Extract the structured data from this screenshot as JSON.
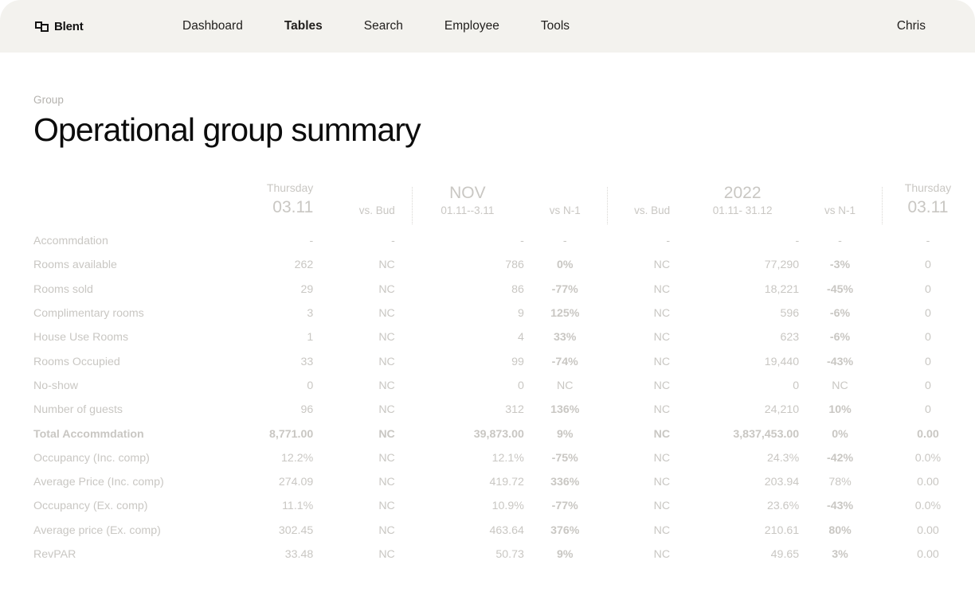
{
  "header": {
    "brand": "Blent",
    "brand_icon": "squares-logo-icon",
    "nav": [
      {
        "label": "Dashboard",
        "active": false
      },
      {
        "label": "Tables",
        "active": true
      },
      {
        "label": "Search",
        "active": false
      },
      {
        "label": "Employee",
        "active": false
      },
      {
        "label": "Tools",
        "active": false
      }
    ],
    "user": "Chris"
  },
  "page": {
    "eyebrow": "Group",
    "title": "Operational group summary"
  },
  "table": {
    "columns": [
      {
        "key": "label",
        "top": "",
        "big": "",
        "sub": ""
      },
      {
        "key": "day1",
        "top": "Thursday",
        "big": "03.11",
        "sub": ""
      },
      {
        "key": "bud1",
        "top": "",
        "big": "",
        "sub": "vs. Bud"
      },
      {
        "key": "nov",
        "top": "",
        "big": "NOV",
        "sub": "01.11--3.11"
      },
      {
        "key": "n1a",
        "top": "",
        "big": "",
        "sub": "vs N-1"
      },
      {
        "key": "bud2",
        "top": "",
        "big": "",
        "sub": "vs. Bud"
      },
      {
        "key": "year",
        "top": "",
        "big": "2022",
        "sub": "01.11- 31.12"
      },
      {
        "key": "n1b",
        "top": "",
        "big": "",
        "sub": "vs N-1"
      },
      {
        "key": "day2",
        "top": "Thursday",
        "big": "03.11",
        "sub": ""
      }
    ],
    "rows": [
      {
        "label": "Accommdation",
        "total": false,
        "cells": [
          {
            "v": "-",
            "tone": "muted"
          },
          {
            "v": "-",
            "tone": "muted"
          },
          {
            "v": "-",
            "tone": "muted"
          },
          {
            "v": "-",
            "tone": "muted"
          },
          {
            "v": "-",
            "tone": "muted"
          },
          {
            "v": "-",
            "tone": "muted"
          },
          {
            "v": "-",
            "tone": "muted"
          },
          {
            "v": "-",
            "tone": "muted"
          }
        ]
      },
      {
        "label": "Rooms available",
        "total": false,
        "cells": [
          {
            "v": "262",
            "tone": "muted"
          },
          {
            "v": "NC",
            "tone": "muted"
          },
          {
            "v": "786",
            "tone": "muted"
          },
          {
            "v": "0%",
            "tone": "pos"
          },
          {
            "v": "NC",
            "tone": "muted"
          },
          {
            "v": "77,290",
            "tone": "muted"
          },
          {
            "v": "-3%",
            "tone": "neg"
          },
          {
            "v": "0",
            "tone": "muted"
          }
        ]
      },
      {
        "label": "Rooms sold",
        "total": false,
        "cells": [
          {
            "v": "29",
            "tone": "muted"
          },
          {
            "v": "NC",
            "tone": "muted"
          },
          {
            "v": "86",
            "tone": "muted"
          },
          {
            "v": "-77%",
            "tone": "neg"
          },
          {
            "v": "NC",
            "tone": "muted"
          },
          {
            "v": "18,221",
            "tone": "muted"
          },
          {
            "v": "-45%",
            "tone": "neg"
          },
          {
            "v": "0",
            "tone": "muted"
          }
        ]
      },
      {
        "label": "Complimentary rooms",
        "total": false,
        "cells": [
          {
            "v": "3",
            "tone": "muted"
          },
          {
            "v": "NC",
            "tone": "muted"
          },
          {
            "v": "9",
            "tone": "muted"
          },
          {
            "v": "125%",
            "tone": "pos"
          },
          {
            "v": "NC",
            "tone": "muted"
          },
          {
            "v": "596",
            "tone": "muted"
          },
          {
            "v": "-6%",
            "tone": "neg"
          },
          {
            "v": "0",
            "tone": "muted"
          }
        ]
      },
      {
        "label": "House Use Rooms",
        "total": false,
        "cells": [
          {
            "v": "1",
            "tone": "muted"
          },
          {
            "v": "NC",
            "tone": "muted"
          },
          {
            "v": "4",
            "tone": "muted"
          },
          {
            "v": "33%",
            "tone": "pos"
          },
          {
            "v": "NC",
            "tone": "muted"
          },
          {
            "v": "623",
            "tone": "muted"
          },
          {
            "v": "-6%",
            "tone": "neg"
          },
          {
            "v": "0",
            "tone": "muted"
          }
        ]
      },
      {
        "label": "Rooms Occupied",
        "total": false,
        "cells": [
          {
            "v": "33",
            "tone": "muted"
          },
          {
            "v": "NC",
            "tone": "muted"
          },
          {
            "v": "99",
            "tone": "muted"
          },
          {
            "v": "-74%",
            "tone": "neg"
          },
          {
            "v": "NC",
            "tone": "muted"
          },
          {
            "v": "19,440",
            "tone": "muted"
          },
          {
            "v": "-43%",
            "tone": "neg"
          },
          {
            "v": "0",
            "tone": "muted"
          }
        ]
      },
      {
        "label": "No-show",
        "total": false,
        "cells": [
          {
            "v": "0",
            "tone": "muted"
          },
          {
            "v": "NC",
            "tone": "muted"
          },
          {
            "v": "0",
            "tone": "muted"
          },
          {
            "v": "NC",
            "tone": "muted"
          },
          {
            "v": "NC",
            "tone": "muted"
          },
          {
            "v": "0",
            "tone": "muted"
          },
          {
            "v": "NC",
            "tone": "muted"
          },
          {
            "v": "0",
            "tone": "muted"
          }
        ]
      },
      {
        "label": "Number of guests",
        "total": false,
        "cells": [
          {
            "v": "96",
            "tone": "muted"
          },
          {
            "v": "NC",
            "tone": "muted"
          },
          {
            "v": "312",
            "tone": "muted"
          },
          {
            "v": "136%",
            "tone": "pos"
          },
          {
            "v": "NC",
            "tone": "muted"
          },
          {
            "v": "24,210",
            "tone": "muted"
          },
          {
            "v": "10%",
            "tone": "pos"
          },
          {
            "v": "0",
            "tone": "muted"
          }
        ]
      },
      {
        "label": "Total Accommdation",
        "total": true,
        "cells": [
          {
            "v": "8,771.00",
            "tone": "muted"
          },
          {
            "v": "NC",
            "tone": "muted"
          },
          {
            "v": "39,873.00",
            "tone": "muted"
          },
          {
            "v": "9%",
            "tone": "pos"
          },
          {
            "v": "NC",
            "tone": "muted"
          },
          {
            "v": "3,837,453.00",
            "tone": "muted"
          },
          {
            "v": "0%",
            "tone": "pos"
          },
          {
            "v": "0.00",
            "tone": "muted"
          }
        ]
      },
      {
        "label": "Occupancy (Inc. comp)",
        "total": false,
        "cells": [
          {
            "v": "12.2%",
            "tone": "muted"
          },
          {
            "v": "NC",
            "tone": "muted"
          },
          {
            "v": "12.1%",
            "tone": "muted"
          },
          {
            "v": "-75%",
            "tone": "neg"
          },
          {
            "v": "NC",
            "tone": "muted"
          },
          {
            "v": "24.3%",
            "tone": "muted"
          },
          {
            "v": "-42%",
            "tone": "neg"
          },
          {
            "v": "0.0%",
            "tone": "muted"
          }
        ]
      },
      {
        "label": "Average Price (Inc. comp)",
        "total": false,
        "cells": [
          {
            "v": "274.09",
            "tone": "muted"
          },
          {
            "v": "NC",
            "tone": "muted"
          },
          {
            "v": "419.72",
            "tone": "muted"
          },
          {
            "v": "336%",
            "tone": "pos"
          },
          {
            "v": "NC",
            "tone": "muted"
          },
          {
            "v": "203.94",
            "tone": "muted"
          },
          {
            "v": "78%",
            "tone": "muted"
          },
          {
            "v": "0.00",
            "tone": "muted"
          }
        ]
      },
      {
        "label": "Occupancy (Ex. comp)",
        "total": false,
        "cells": [
          {
            "v": "11.1%",
            "tone": "muted"
          },
          {
            "v": "NC",
            "tone": "muted"
          },
          {
            "v": "10.9%",
            "tone": "muted"
          },
          {
            "v": "-77%",
            "tone": "neg"
          },
          {
            "v": "NC",
            "tone": "muted"
          },
          {
            "v": "23.6%",
            "tone": "muted"
          },
          {
            "v": "-43%",
            "tone": "neg"
          },
          {
            "v": "0.0%",
            "tone": "muted"
          }
        ]
      },
      {
        "label": "Average price (Ex. comp)",
        "total": false,
        "cells": [
          {
            "v": "302.45",
            "tone": "muted"
          },
          {
            "v": "NC",
            "tone": "muted"
          },
          {
            "v": "463.64",
            "tone": "muted"
          },
          {
            "v": "376%",
            "tone": "pos"
          },
          {
            "v": "NC",
            "tone": "muted"
          },
          {
            "v": "210.61",
            "tone": "muted"
          },
          {
            "v": "80%",
            "tone": "pos"
          },
          {
            "v": "0.00",
            "tone": "muted"
          }
        ]
      },
      {
        "label": "RevPAR",
        "total": false,
        "cells": [
          {
            "v": "33.48",
            "tone": "muted"
          },
          {
            "v": "NC",
            "tone": "muted"
          },
          {
            "v": "50.73",
            "tone": "muted"
          },
          {
            "v": "9%",
            "tone": "pos"
          },
          {
            "v": "NC",
            "tone": "muted"
          },
          {
            "v": "49.65",
            "tone": "muted"
          },
          {
            "v": "3%",
            "tone": "pos"
          },
          {
            "v": "0.00",
            "tone": "muted"
          }
        ]
      }
    ]
  },
  "colors": {
    "positive": "#4caf50",
    "negative": "#f0403c",
    "muted": "#c9c7c3",
    "header_bg": "#f3f2ee"
  }
}
